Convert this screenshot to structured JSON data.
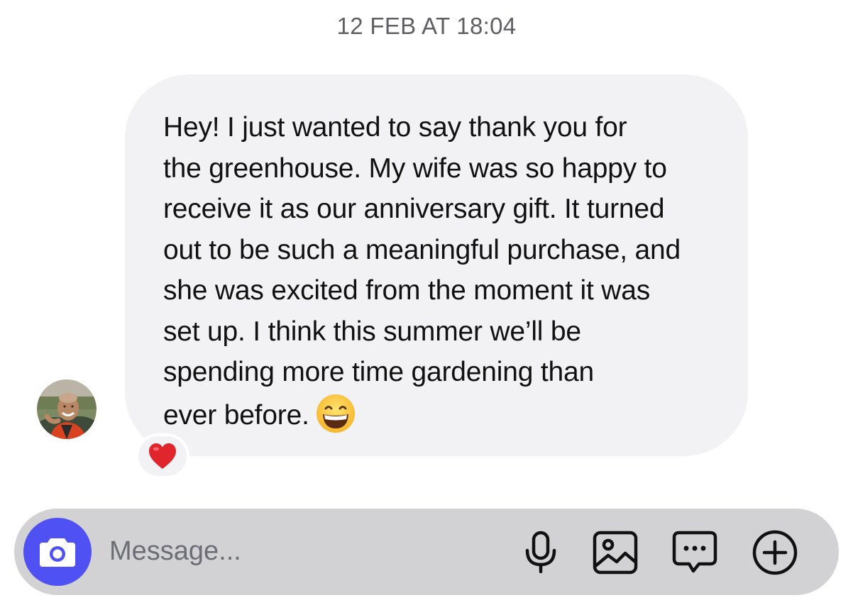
{
  "chat": {
    "timestamp": "12 FEB AT 18:04",
    "message": {
      "lines": [
        "Hey! I just wanted to say thank you for",
        "the greenhouse. My wife was so happy to",
        "receive it as our anniversary gift. It turned",
        "out to be such a meaningful purchase, and",
        "she was excited from the moment it was",
        "set up. I think this summer we’ll be",
        "spending more time gardening than",
        "ever before."
      ],
      "emoji": "grinning-face-with-smiling-eyes",
      "reaction": "red-heart"
    }
  },
  "composer": {
    "placeholder": "Message...",
    "camera_icon": "camera-icon",
    "icons": [
      "microphone-icon",
      "gallery-icon",
      "sticker-chat-icon",
      "add-circle-icon"
    ]
  },
  "colors": {
    "bubble_bg": "#f2f2f4",
    "composer_bg": "#d2d2d5",
    "camera_btn": "#5051f3",
    "timestamp_text": "#5f5f64",
    "placeholder_text": "#6c6e75",
    "heart": "#e0252d"
  }
}
